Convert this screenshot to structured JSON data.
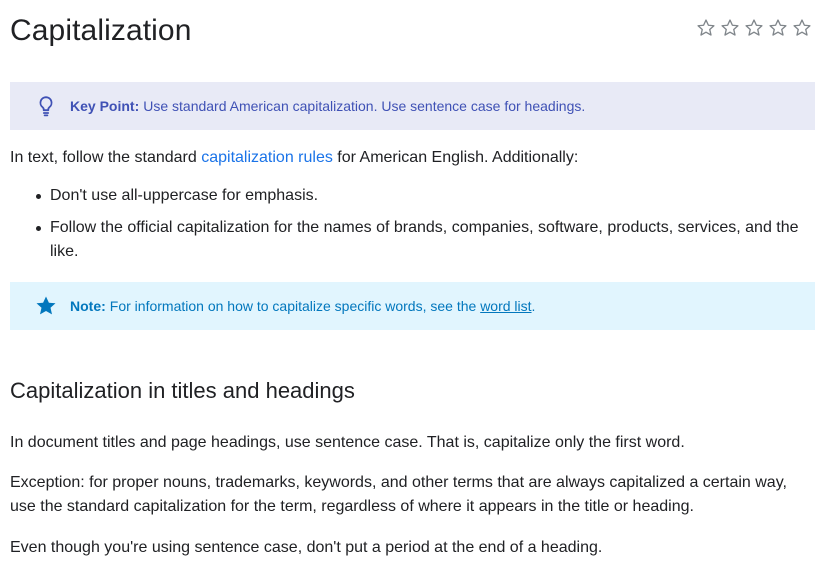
{
  "page": {
    "title": "Capitalization",
    "rating_stars": 5
  },
  "key_point": {
    "label": "Key Point:",
    "text": "Use standard American capitalization. Use sentence case for headings.",
    "icon": "lightbulb-icon"
  },
  "intro": {
    "before": "In text, follow the standard ",
    "link": "capitalization rules",
    "after": " for American English. Additionally:"
  },
  "bullets": [
    "Don't use all-uppercase for emphasis.",
    "Follow the official capitalization for the names of brands, companies, software, products, services, and the like."
  ],
  "note": {
    "label": "Note:",
    "text_before": "For information on how to capitalize specific words, see the ",
    "link": "word list",
    "text_after": ".",
    "icon": "star-icon"
  },
  "section": {
    "heading": "Capitalization in titles and headings",
    "paragraphs": [
      "In document titles and page headings, use sentence case. That is, capitalize only the first word.",
      "Exception: for proper nouns, trademarks, keywords, and other terms that are always capitalized a certain way, use the standard capitalization for the term, regardless of where it appears in the title or heading.",
      "Even though you're using sentence case, don't put a period at the end of a heading."
    ]
  },
  "colors": {
    "key_point_bg": "#e8eaf6",
    "key_point_fg": "#3f51b5",
    "note_bg": "#e1f5fe",
    "note_fg": "#0277bd",
    "link": "#1a73e8"
  }
}
